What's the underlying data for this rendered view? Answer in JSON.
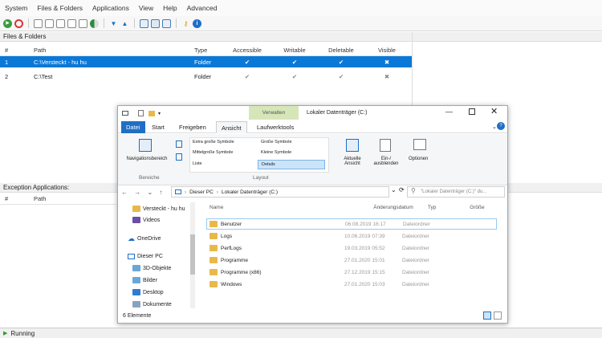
{
  "menu": [
    "System",
    "Files & Folders",
    "Applications",
    "View",
    "Help",
    "Advanced"
  ],
  "toolbar_icons": [
    "play-icon",
    "stop-icon",
    "add-file-icon",
    "add-folder-icon",
    "delete-icon",
    "edit-icon",
    "properties-icon",
    "contrast-icon",
    "down-arrow-icon",
    "up-arrow-icon",
    "window-icon",
    "image-icon",
    "export-icon",
    "key-icon",
    "info-icon"
  ],
  "files_section": {
    "title": "Files & Folders",
    "columns": [
      "#",
      "Path",
      "Type",
      "Accessible",
      "Writable",
      "Deletable",
      "Visible"
    ],
    "rows": [
      {
        "num": "1",
        "path": "C:\\Versteckt - hu hu",
        "type": "Folder",
        "accessible": "✔",
        "writable": "✔",
        "deletable": "✔",
        "visible": "✖"
      },
      {
        "num": "2",
        "path": "C:\\Test",
        "type": "Folder",
        "accessible": "✔",
        "writable": "✔",
        "deletable": "✔",
        "visible": "✖"
      }
    ]
  },
  "exception_section": {
    "title": "Exception Applications:",
    "columns": [
      "#",
      "Path"
    ]
  },
  "status": {
    "text": "Running"
  },
  "explorer": {
    "context_tab": "Verwalten",
    "title": "Lokaler Datenträger (C:)",
    "ribbon_tabs": [
      "Datei",
      "Start",
      "Freigeben",
      "Ansicht",
      "Laufwerktools"
    ],
    "ribbon": {
      "nav_pane": "Navigationsbereich",
      "group1": "Bereiche",
      "layout_items": [
        "Extra große Symbole",
        "Große Symbole",
        "Mittelgroße Symbole",
        "Kleine Symbole",
        "Liste",
        "Details"
      ],
      "group2": "Layout",
      "current_view": "Aktuelle Ansicht",
      "show_hide": "Ein-/ ausblenden",
      "options": "Optionen"
    },
    "address": {
      "path_root": "Dieser PC",
      "path_current": "Lokaler Datenträger (C:)",
      "search_placeholder": "\"Lokaler Datenträger (C:)\" du..."
    },
    "nav": [
      {
        "label": "Versteckt - hu hu",
        "type": "folder"
      },
      {
        "label": "Videos",
        "type": "folder"
      },
      {
        "label": "OneDrive",
        "type": "cloud"
      },
      {
        "label": "Dieser PC",
        "type": "pc"
      },
      {
        "label": "3D-Objekte",
        "type": "folder"
      },
      {
        "label": "Bilder",
        "type": "folder"
      },
      {
        "label": "Desktop",
        "type": "folder"
      },
      {
        "label": "Dokumente",
        "type": "folder"
      }
    ],
    "columns": [
      "Name",
      "Änderungsdatum",
      "Typ",
      "Größe"
    ],
    "files": [
      {
        "name": "Benutzer",
        "date": "06.08.2019 16:17",
        "type": "Dateiordner"
      },
      {
        "name": "Logs",
        "date": "10.06.2019 07:39",
        "type": "Dateiordner"
      },
      {
        "name": "PerfLogs",
        "date": "19.03.2019 05:52",
        "type": "Dateiordner"
      },
      {
        "name": "Programme",
        "date": "27.01.2020 15:01",
        "type": "Dateiordner"
      },
      {
        "name": "Programme (x86)",
        "date": "27.12.2019 15:15",
        "type": "Dateiordner"
      },
      {
        "name": "Windows",
        "date": "27.01.2020 15:03",
        "type": "Dateiordner"
      }
    ],
    "status": "6 Elemente"
  },
  "colors": {
    "accent": "#0a78d7",
    "context_tab": "#d6e6b8",
    "folder": "#e8b94a"
  }
}
